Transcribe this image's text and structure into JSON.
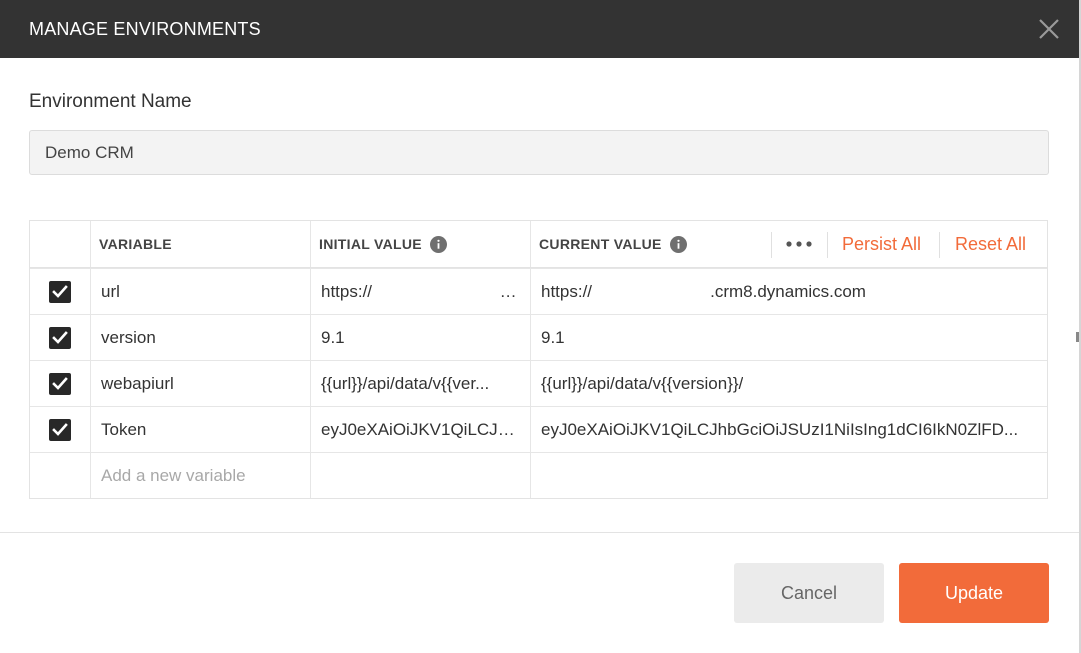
{
  "dialog": {
    "title": "MANAGE ENVIRONMENTS",
    "close_icon": "close-icon"
  },
  "environment": {
    "label": "Environment Name",
    "value": "Demo CRM"
  },
  "table": {
    "headers": {
      "variable": "VARIABLE",
      "initial_value": "INITIAL VALUE",
      "current_value": "CURRENT VALUE"
    },
    "actions": {
      "more_icon": "more-horizontal-icon",
      "persist_all": "Persist All",
      "reset_all": "Reset All"
    },
    "rows": [
      {
        "checked": true,
        "variable": "url",
        "initial_value": "https://                                  ..",
        "current_value": "https://                         .crm8.dynamics.com"
      },
      {
        "checked": true,
        "variable": "version",
        "initial_value": "9.1",
        "current_value": "9.1"
      },
      {
        "checked": true,
        "variable": "webapiurl",
        "initial_value": "{{url}}/api/data/v{{ver...",
        "current_value": "{{url}}/api/data/v{{version}}/"
      },
      {
        "checked": true,
        "variable": "Token",
        "initial_value": "eyJ0eXAiOiJKV1QiLCJh...",
        "current_value": "eyJ0eXAiOiJKV1QiLCJhbGciOiJSUzI1NiIsIng1dCI6IkN0ZlFD..."
      }
    ],
    "new_variable_placeholder": "Add a new variable"
  },
  "footer": {
    "cancel_label": "Cancel",
    "update_label": "Update"
  },
  "colors": {
    "header_bg": "#333333",
    "accent": "#f26b3a",
    "checkbox": "#282828"
  }
}
